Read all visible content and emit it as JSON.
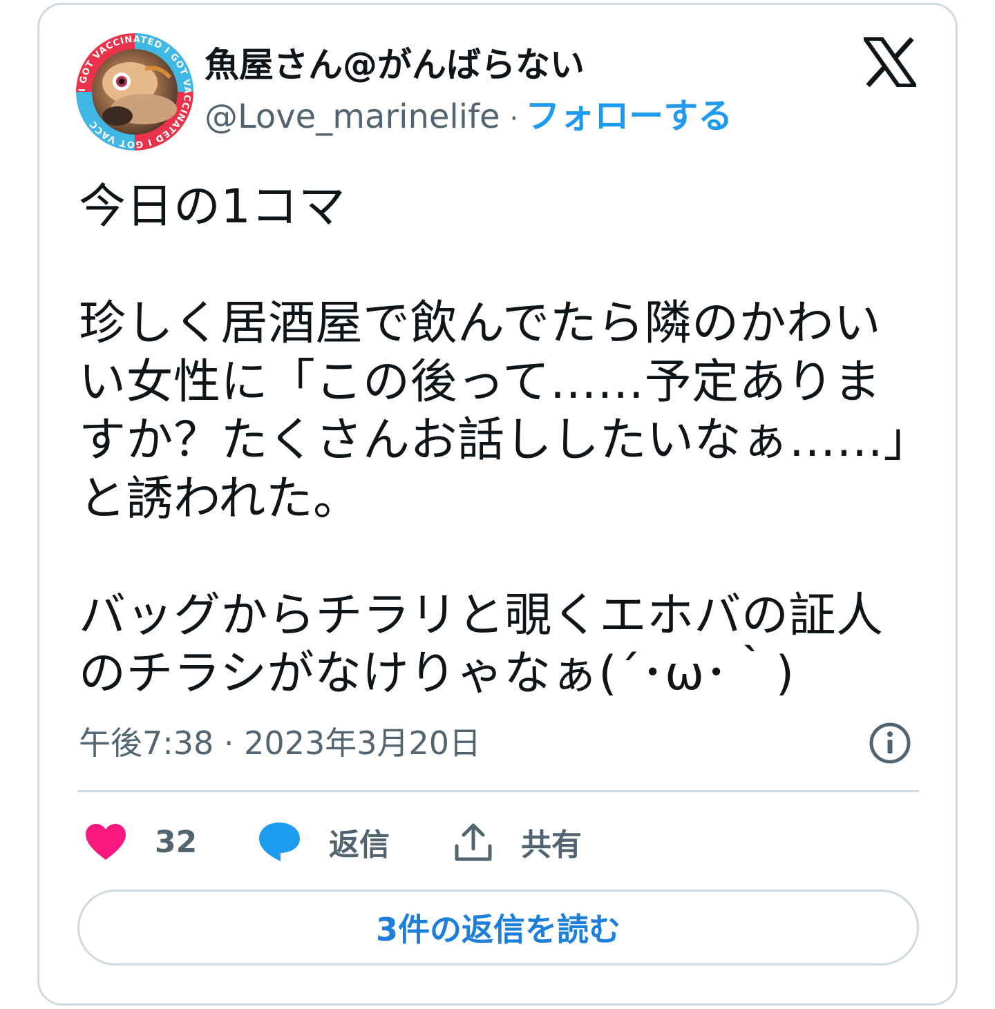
{
  "user": {
    "display_name": "魚屋さん@がんばらない",
    "handle": "@Love_marinelife",
    "separator": "·",
    "follow_label": "フォローする",
    "avatar_badge_text": "I GOT VACCINATED"
  },
  "platform": {
    "logo_icon": "x-logo-icon"
  },
  "tweet": {
    "text": "今日の1コマ\n\n珍しく居酒屋で飲んでたら隣のかわいい女性に「この後って……予定ありますか？たくさんお話ししたいなぁ……」と誘われた。\n\nバッグからチラリと覗くエホバの証人のチラシがなけりゃなぁ(´･ω･｀)",
    "timestamp": "午後7:38 · 2023年3月20日"
  },
  "actions": {
    "like_count": "32",
    "reply_label": "返信",
    "share_label": "共有"
  },
  "read_replies_label": "3件の返信を読む",
  "colors": {
    "accent": "#1d9bf0",
    "like": "#f91880",
    "muted": "#536471",
    "border": "#cfd9de",
    "text": "#0f1419"
  }
}
